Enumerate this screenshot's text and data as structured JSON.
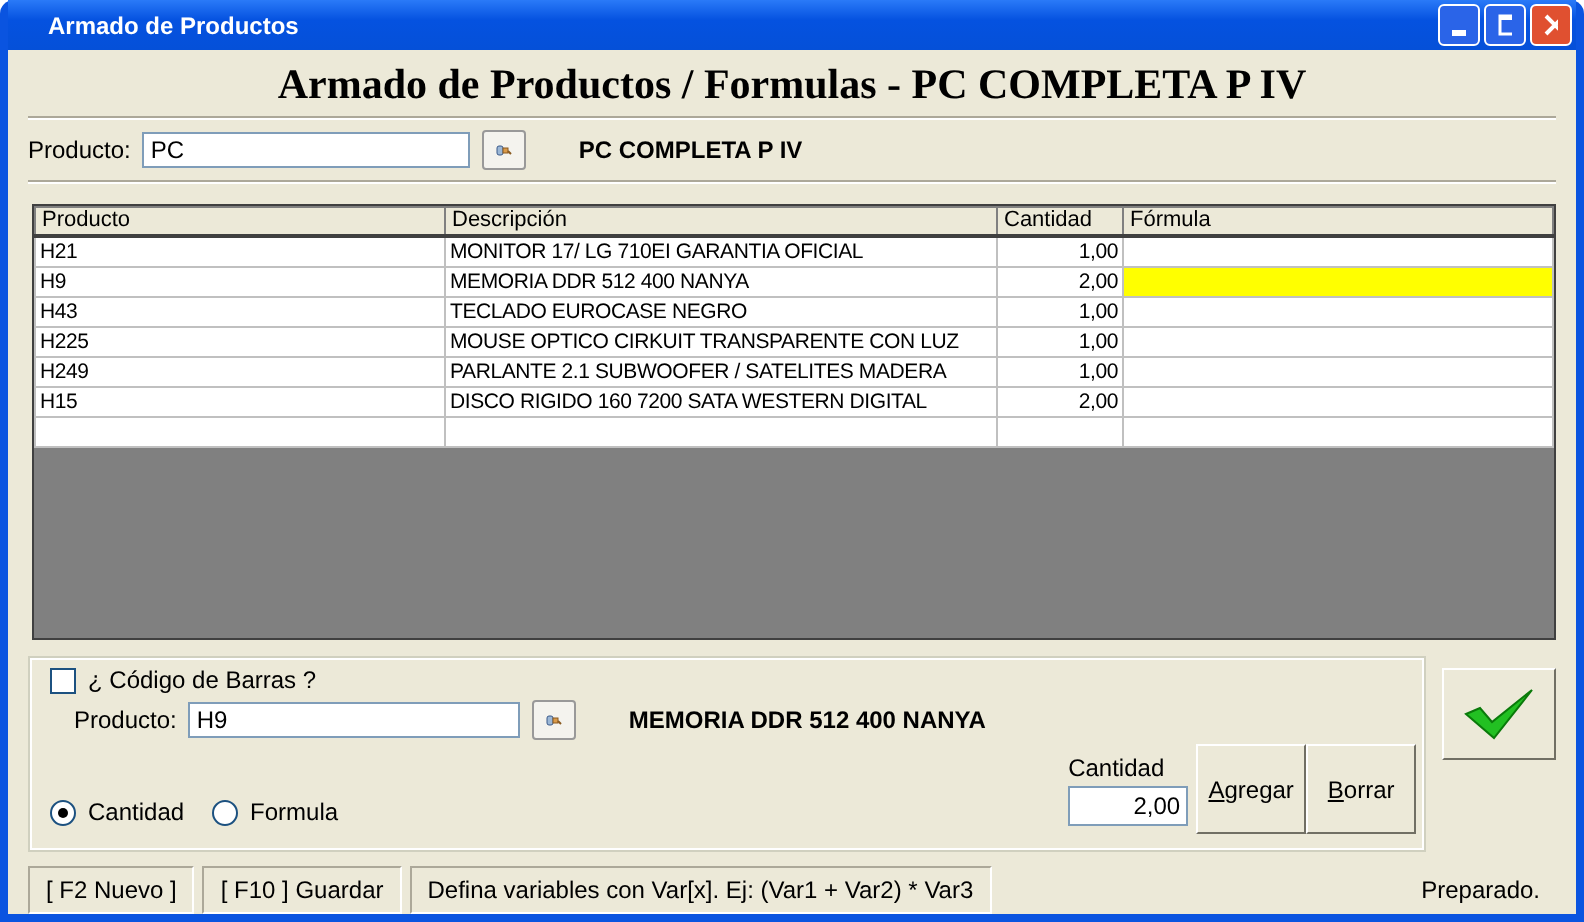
{
  "window": {
    "title": "Armado de Productos"
  },
  "heading": "Armado de Productos / Formulas - PC COMPLETA P IV",
  "product": {
    "label": "Producto:",
    "value": "PC",
    "description": "PC COMPLETA P IV"
  },
  "table": {
    "columns": [
      "Producto",
      "Descripción",
      "Cantidad",
      "Fórmula"
    ],
    "rows": [
      {
        "code": "H21",
        "description": "MONITOR 17/ LG 710EI GARANTIA OFICIAL",
        "quantity": "1,00",
        "selected": false
      },
      {
        "code": "H9",
        "description": "MEMORIA DDR 512 400 NANYA",
        "quantity": "2,00",
        "selected": true
      },
      {
        "code": "H43",
        "description": "TECLADO EUROCASE NEGRO",
        "quantity": "1,00",
        "selected": false
      },
      {
        "code": "H225",
        "description": "MOUSE OPTICO CIRKUIT TRANSPARENTE CON LUZ",
        "quantity": "1,00",
        "selected": false
      },
      {
        "code": "H249",
        "description": "PARLANTE 2.1 SUBWOOFER / SATELITES MADERA",
        "quantity": "1,00",
        "selected": false
      },
      {
        "code": "H15",
        "description": "DISCO RIGIDO 160 7200 SATA WESTERN DIGITAL",
        "quantity": "2,00",
        "selected": false
      }
    ]
  },
  "entry": {
    "barcode": {
      "label": "¿ Código de Barras ?",
      "checked": false
    },
    "product": {
      "label": "Producto:",
      "value": "H9",
      "description": "MEMORIA DDR 512 400 NANYA"
    },
    "modes": [
      {
        "label": "Cantidad",
        "selected": true
      },
      {
        "label": "Formula",
        "selected": false
      }
    ],
    "quantity": {
      "label": "Cantidad",
      "value": "2,00"
    },
    "buttons": [
      "Agregar",
      "Borrar"
    ]
  },
  "status_bar": [
    "[ F2 Nuevo ]",
    "[ F10 ] Guardar",
    "Defina variables con Var[x]. Ej: (Var1 + Var2) * Var3",
    "Preparado."
  ]
}
